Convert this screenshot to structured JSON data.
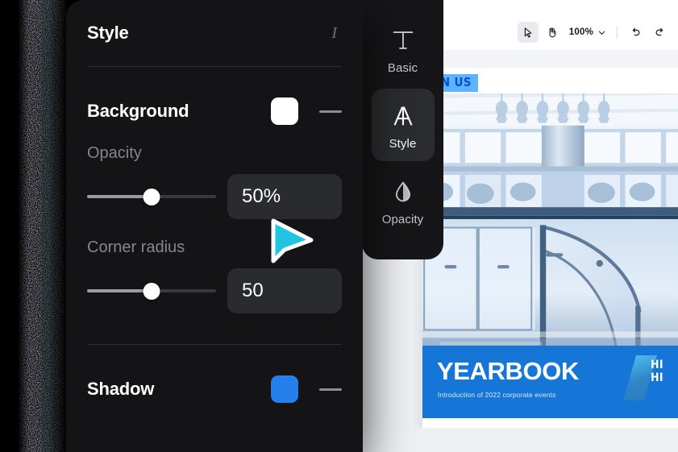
{
  "panel": {
    "header": {
      "title": "Style",
      "italic_icon": "italic-icon"
    },
    "background": {
      "label": "Background",
      "swatch_color": "#ffffff",
      "dash": "—"
    },
    "opacity": {
      "label": "Opacity",
      "value": "50%",
      "slider_percent": 50
    },
    "corner_radius": {
      "label": "Corner radius",
      "value": "50",
      "slider_percent": 50
    },
    "shadow": {
      "label": "Shadow",
      "swatch_color": "#2680eb",
      "dash": "—"
    }
  },
  "rail": {
    "items": [
      {
        "label": "Basic",
        "icon": "text-t-icon",
        "active": false
      },
      {
        "label": "Style",
        "icon": "letter-a-style-icon",
        "active": true
      },
      {
        "label": "Opacity",
        "icon": "droplet-icon",
        "active": false
      }
    ]
  },
  "toolbar": {
    "select_tool": "cursor-arrow-icon",
    "hand_tool": "hand-icon",
    "zoom_level": "100%",
    "zoom_chevron": "chevron-down-icon",
    "undo": "undo-icon",
    "redo": "redo-icon"
  },
  "document": {
    "badge": "JOIN US",
    "title": "YEARBOOK",
    "subtitle": "Introduction of 2022 corporate events",
    "corner_mark_line1": "HI",
    "corner_mark_line2": "HI",
    "title_block_color": "#1576d8",
    "photo_alt": "modern glass office atrium"
  },
  "cursor": {
    "name": "pointer-cursor",
    "fill": "#21c5e0"
  }
}
